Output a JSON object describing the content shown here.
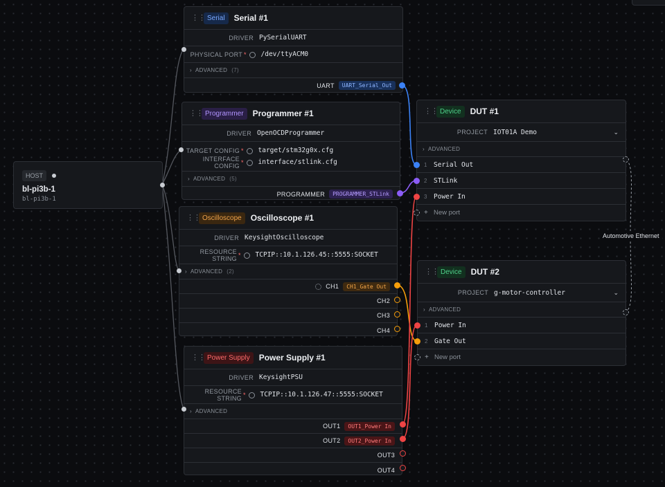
{
  "host": {
    "tag": "HOST",
    "title": "bl-pi3b-1",
    "subtitle": "bl-pi3b-1"
  },
  "serial": {
    "tag": "Serial",
    "title": "Serial #1",
    "driver_key": "DRIVER",
    "driver": "PySerialUART",
    "port_key": "PHYSICAL PORT",
    "port": "/dev/ttyACM0",
    "adv": "ADVANCED",
    "adv_count": "(7)",
    "out_label": "UART",
    "out_pill": "UART_Serial_Out"
  },
  "programmer": {
    "tag": "Programmer",
    "title": "Programmer #1",
    "driver_key": "DRIVER",
    "driver": "OpenOCDProgrammer",
    "target_key": "TARGET CONFIG",
    "target": "target/stm32g0x.cfg",
    "iface_key": "INTERFACE CONFIG",
    "iface": "interface/stlink.cfg",
    "adv": "ADVANCED",
    "adv_count": "(5)",
    "out_label": "PROGRAMMER",
    "out_pill": "PROGRAMMER_STLink"
  },
  "scope": {
    "tag": "Oscilloscope",
    "title": "Oscilloscope #1",
    "driver_key": "DRIVER",
    "driver": "KeysightOscilloscope",
    "res_key": "RESOURCE STRING",
    "res": "TCPIP::10.1.126.45::5555:SOCKET",
    "adv": "ADVANCED",
    "adv_count": "(2)",
    "ch1": "CH1",
    "ch1_pill": "CH1_Gate Out",
    "ch2": "CH2",
    "ch3": "CH3",
    "ch4": "CH4"
  },
  "psu": {
    "tag": "Power Supply",
    "title": "Power Supply #1",
    "driver_key": "DRIVER",
    "driver": "KeysightPSU",
    "res_key": "RESOURCE STRING",
    "res": "TCPIP::10.1.126.47::5555:SOCKET",
    "adv": "ADVANCED",
    "out1": "OUT1",
    "out1_pill": "OUT1_Power In",
    "out2": "OUT2",
    "out2_pill": "OUT2_Power In",
    "out3": "OUT3",
    "out4": "OUT4"
  },
  "dut1": {
    "tag": "Device",
    "title": "DUT #1",
    "project_key": "PROJECT",
    "project": "IOT01A Demo",
    "adv": "ADVANCED",
    "ports": [
      {
        "num": "1",
        "name": "Serial Out"
      },
      {
        "num": "2",
        "name": "STLink"
      },
      {
        "num": "3",
        "name": "Power In"
      }
    ],
    "new_port": "New port"
  },
  "dut2": {
    "tag": "Device",
    "title": "DUT #2",
    "project_key": "PROJECT",
    "project": "g-motor-controller",
    "adv": "ADVANCED",
    "ports": [
      {
        "num": "1",
        "name": "Power In"
      },
      {
        "num": "2",
        "name": "Gate Out"
      }
    ],
    "new_port": "New port"
  },
  "edge_label": "Automotive Ethernet",
  "colors": {
    "serial": "#3b82f6",
    "programmer": "#8b5cf6",
    "scope": "#f59e0b",
    "power": "#ef4444",
    "wire": "#4a4d54",
    "background": "#0b0c0f"
  }
}
